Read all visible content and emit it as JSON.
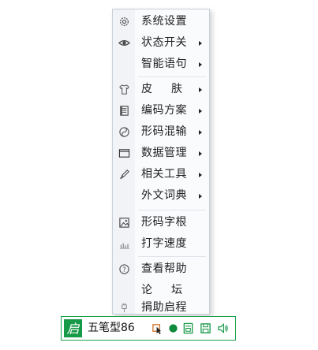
{
  "menu": {
    "items": [
      {
        "label": "系统设置",
        "icon": "gear-icon"
      },
      {
        "label": "状态开关",
        "icon": "eye-icon",
        "submenu": true
      },
      {
        "label": "智能语句",
        "icon": "",
        "submenu": true
      },
      {
        "label": "皮肤",
        "icon": "tshirt-icon",
        "submenu": true
      },
      {
        "label": "编码方案",
        "icon": "codebook-icon",
        "submenu": true
      },
      {
        "label": "形码混输",
        "icon": "yin-yang-icon",
        "submenu": true
      },
      {
        "label": "数据管理",
        "icon": "folder-icon",
        "submenu": true
      },
      {
        "label": "相关工具",
        "icon": "brush-icon",
        "submenu": true
      },
      {
        "label": "外文词典",
        "icon": "",
        "submenu": true
      },
      {
        "label": "形码字根",
        "icon": "image-icon"
      },
      {
        "label": "打字速度",
        "icon": "bar-chart-icon"
      },
      {
        "label": "查看帮助",
        "icon": "help-icon"
      },
      {
        "label": "论坛",
        "icon": ""
      },
      {
        "label": "捐助启程",
        "icon": "plug-icon"
      }
    ]
  },
  "status_bar": {
    "logo_glyph": "启",
    "mode_label": "五笔型86",
    "tools": [
      "cursor-icon",
      "dot-icon",
      "calculator-icon",
      "save-icon",
      "speaker-icon"
    ]
  },
  "colors": {
    "accent_green": "#179a48",
    "menu_bg": "#fafbfd",
    "menu_border": "#c9cfd8"
  }
}
